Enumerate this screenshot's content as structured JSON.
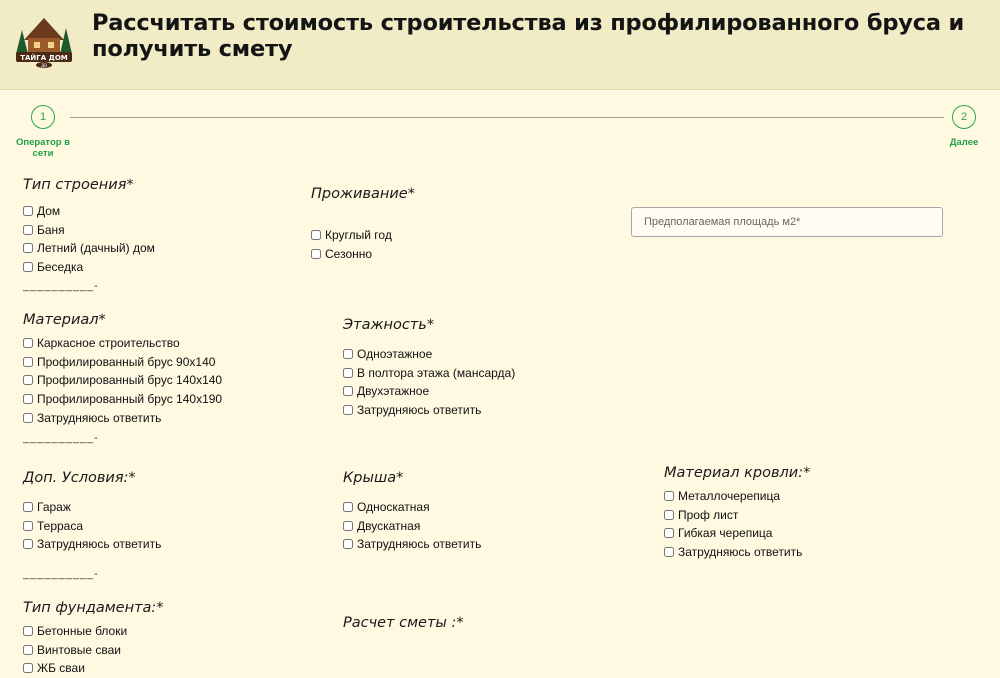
{
  "header": {
    "title": "Рассчитать стоимость строительства из профилированного бруса и получить смету",
    "logo_text": "ТАЙГА ДОМ",
    "logo_sub": "ДВ"
  },
  "progress": {
    "step1_number": "1",
    "step1_label": "Оператор в сети",
    "step2_number": "2",
    "step2_label": "Далее"
  },
  "building_type": {
    "title": "Тип строения*",
    "options": [
      "Дом",
      "Баня",
      "Летний (дачный) дом",
      "Беседка"
    ]
  },
  "residence": {
    "title": "Проживание*",
    "options": [
      "Круглый год",
      "Сезонно"
    ]
  },
  "area": {
    "placeholder": "Предполагаемая площадь м2*"
  },
  "material": {
    "title": "Материал*",
    "options": [
      "Каркасное строительство",
      "Профилированный брус 90х140",
      "Профилированный брус 140х140",
      "Профилированный брус 140х190",
      "Затрудняюсь ответить"
    ]
  },
  "floors": {
    "title": "Этажность*",
    "options": [
      "Одноэтажное",
      "В полтора этажа (мансарда)",
      "Двухэтажное",
      "Затрудняюсь ответить"
    ]
  },
  "extra": {
    "title": "Доп. Условия:*",
    "options": [
      "Гараж",
      "Терраса",
      "Затрудняюсь ответить"
    ]
  },
  "roof": {
    "title": "Крыша*",
    "options": [
      "Односкатная",
      "Двускатная",
      "Затрудняюсь ответить"
    ]
  },
  "roof_material": {
    "title": "Материал кровли:*",
    "options": [
      "Металлочерепица",
      "Проф лист",
      "Гибкая черепица",
      "Затрудняюсь ответить"
    ]
  },
  "foundation": {
    "title": "Тип фундамента:*",
    "options": [
      "Бетонные блоки",
      "Винтовые сваи",
      "ЖБ сваи"
    ]
  },
  "estimate": {
    "title": "Расчет сметы :*"
  },
  "separator": "__________-",
  "colors": {
    "accent": "#2aa84a",
    "header_bg": "#f1ebc6",
    "page_bg": "#fff9e2"
  }
}
